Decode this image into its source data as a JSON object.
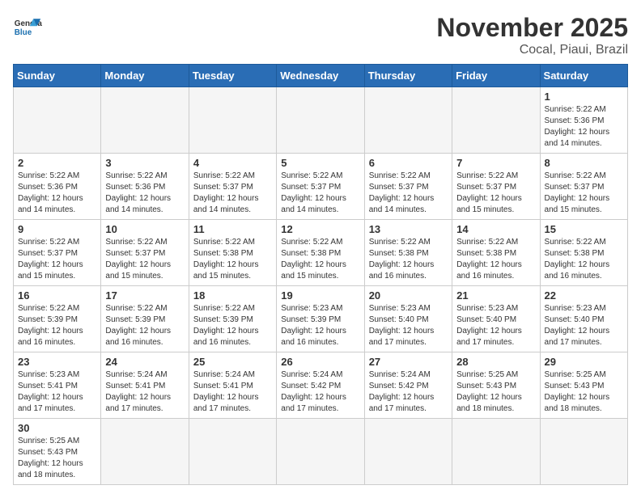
{
  "header": {
    "logo_general": "General",
    "logo_blue": "Blue",
    "month_title": "November 2025",
    "location": "Cocal, Piaui, Brazil"
  },
  "weekdays": [
    "Sunday",
    "Monday",
    "Tuesday",
    "Wednesday",
    "Thursday",
    "Friday",
    "Saturday"
  ],
  "days": {
    "1": {
      "sunrise": "5:22 AM",
      "sunset": "5:36 PM",
      "daylight": "12 hours and 14 minutes."
    },
    "2": {
      "sunrise": "5:22 AM",
      "sunset": "5:36 PM",
      "daylight": "12 hours and 14 minutes."
    },
    "3": {
      "sunrise": "5:22 AM",
      "sunset": "5:36 PM",
      "daylight": "12 hours and 14 minutes."
    },
    "4": {
      "sunrise": "5:22 AM",
      "sunset": "5:37 PM",
      "daylight": "12 hours and 14 minutes."
    },
    "5": {
      "sunrise": "5:22 AM",
      "sunset": "5:37 PM",
      "daylight": "12 hours and 14 minutes."
    },
    "6": {
      "sunrise": "5:22 AM",
      "sunset": "5:37 PM",
      "daylight": "12 hours and 14 minutes."
    },
    "7": {
      "sunrise": "5:22 AM",
      "sunset": "5:37 PM",
      "daylight": "12 hours and 15 minutes."
    },
    "8": {
      "sunrise": "5:22 AM",
      "sunset": "5:37 PM",
      "daylight": "12 hours and 15 minutes."
    },
    "9": {
      "sunrise": "5:22 AM",
      "sunset": "5:37 PM",
      "daylight": "12 hours and 15 minutes."
    },
    "10": {
      "sunrise": "5:22 AM",
      "sunset": "5:37 PM",
      "daylight": "12 hours and 15 minutes."
    },
    "11": {
      "sunrise": "5:22 AM",
      "sunset": "5:38 PM",
      "daylight": "12 hours and 15 minutes."
    },
    "12": {
      "sunrise": "5:22 AM",
      "sunset": "5:38 PM",
      "daylight": "12 hours and 15 minutes."
    },
    "13": {
      "sunrise": "5:22 AM",
      "sunset": "5:38 PM",
      "daylight": "12 hours and 16 minutes."
    },
    "14": {
      "sunrise": "5:22 AM",
      "sunset": "5:38 PM",
      "daylight": "12 hours and 16 minutes."
    },
    "15": {
      "sunrise": "5:22 AM",
      "sunset": "5:38 PM",
      "daylight": "12 hours and 16 minutes."
    },
    "16": {
      "sunrise": "5:22 AM",
      "sunset": "5:39 PM",
      "daylight": "12 hours and 16 minutes."
    },
    "17": {
      "sunrise": "5:22 AM",
      "sunset": "5:39 PM",
      "daylight": "12 hours and 16 minutes."
    },
    "18": {
      "sunrise": "5:22 AM",
      "sunset": "5:39 PM",
      "daylight": "12 hours and 16 minutes."
    },
    "19": {
      "sunrise": "5:23 AM",
      "sunset": "5:39 PM",
      "daylight": "12 hours and 16 minutes."
    },
    "20": {
      "sunrise": "5:23 AM",
      "sunset": "5:40 PM",
      "daylight": "12 hours and 17 minutes."
    },
    "21": {
      "sunrise": "5:23 AM",
      "sunset": "5:40 PM",
      "daylight": "12 hours and 17 minutes."
    },
    "22": {
      "sunrise": "5:23 AM",
      "sunset": "5:40 PM",
      "daylight": "12 hours and 17 minutes."
    },
    "23": {
      "sunrise": "5:23 AM",
      "sunset": "5:41 PM",
      "daylight": "12 hours and 17 minutes."
    },
    "24": {
      "sunrise": "5:24 AM",
      "sunset": "5:41 PM",
      "daylight": "12 hours and 17 minutes."
    },
    "25": {
      "sunrise": "5:24 AM",
      "sunset": "5:41 PM",
      "daylight": "12 hours and 17 minutes."
    },
    "26": {
      "sunrise": "5:24 AM",
      "sunset": "5:42 PM",
      "daylight": "12 hours and 17 minutes."
    },
    "27": {
      "sunrise": "5:24 AM",
      "sunset": "5:42 PM",
      "daylight": "12 hours and 17 minutes."
    },
    "28": {
      "sunrise": "5:25 AM",
      "sunset": "5:43 PM",
      "daylight": "12 hours and 18 minutes."
    },
    "29": {
      "sunrise": "5:25 AM",
      "sunset": "5:43 PM",
      "daylight": "12 hours and 18 minutes."
    },
    "30": {
      "sunrise": "5:25 AM",
      "sunset": "5:43 PM",
      "daylight": "12 hours and 18 minutes."
    }
  }
}
